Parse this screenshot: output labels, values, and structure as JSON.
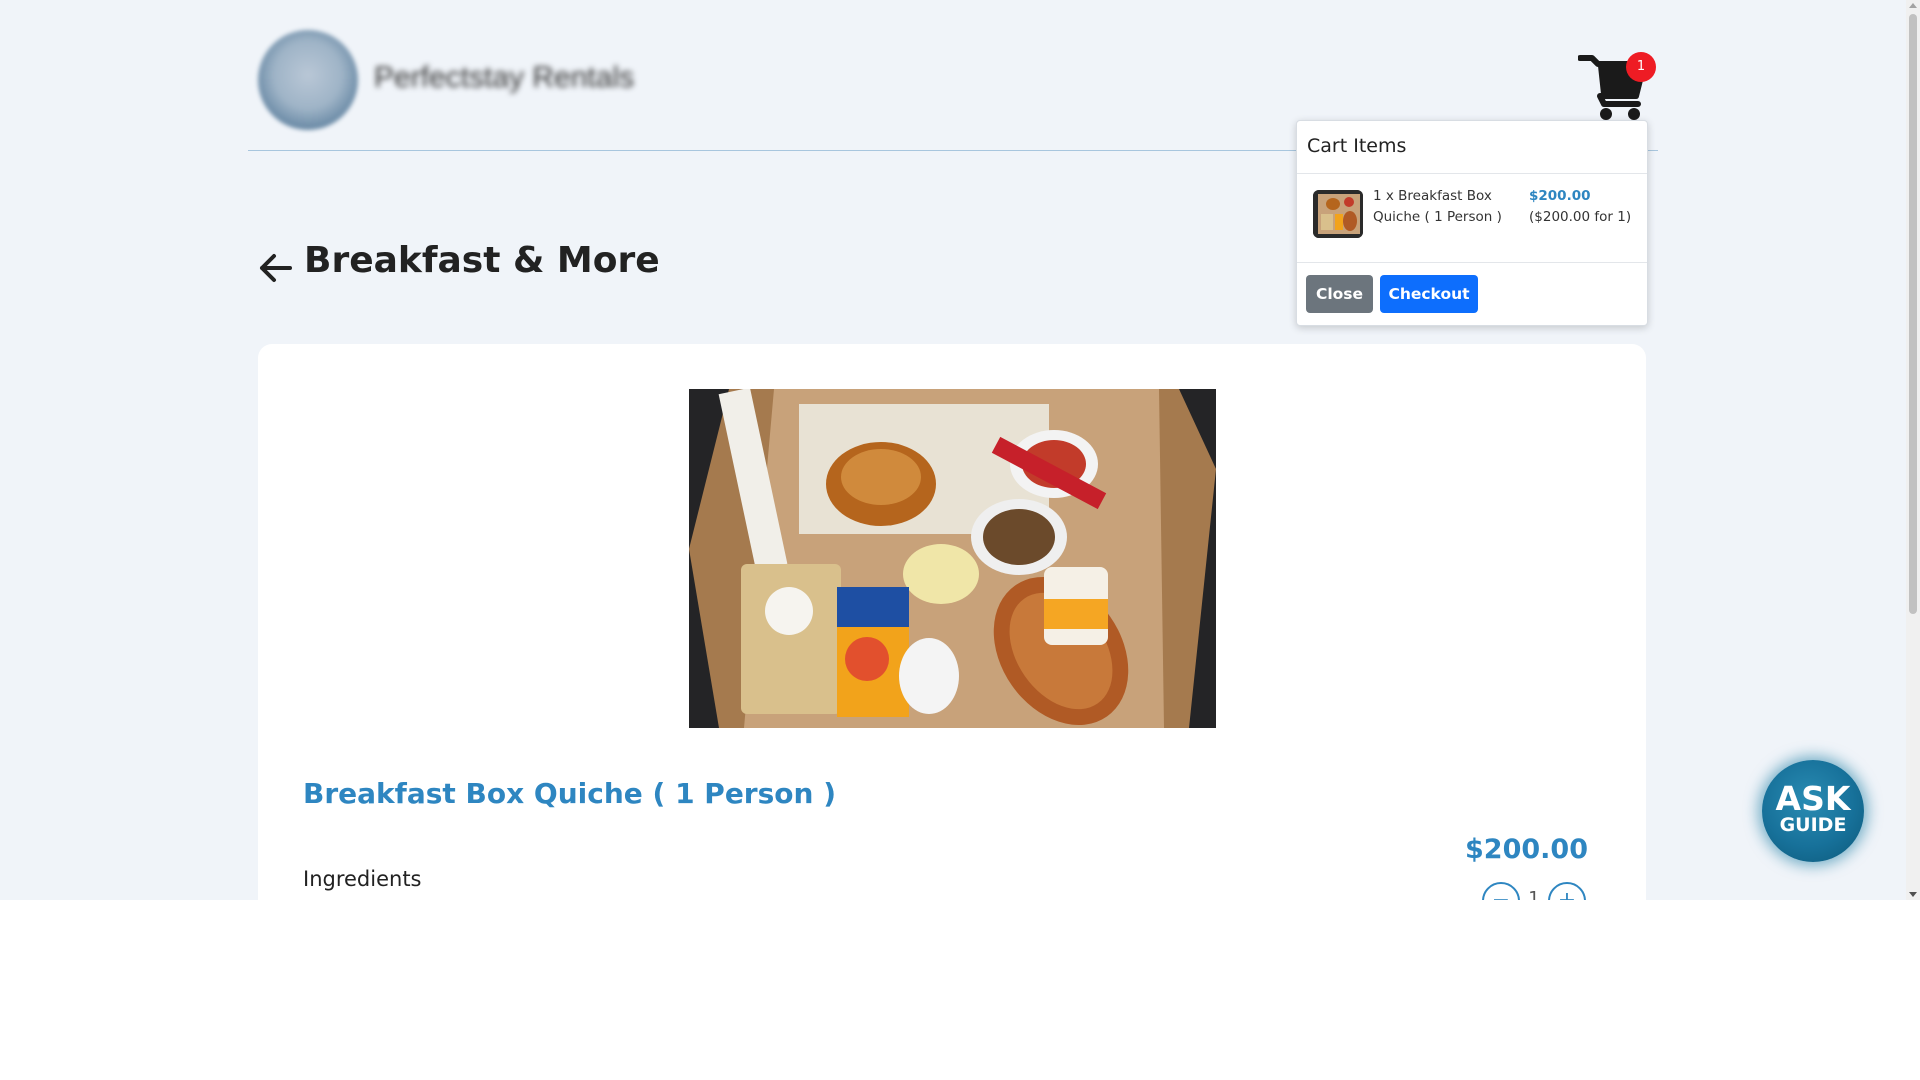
{
  "header": {
    "brand_name": "Perfectstay Rentals",
    "cart_count": "1"
  },
  "page": {
    "title": "Breakfast & More"
  },
  "product": {
    "name": "Breakfast Box Quiche ( 1 Person )",
    "ingredients_label": "Ingredients",
    "price": "$200.00",
    "quantity": "1",
    "minus_symbol": "−",
    "plus_symbol": "+"
  },
  "cart_popup": {
    "title": "Cart Items",
    "items": [
      {
        "description": "1 x Breakfast Box Quiche ( 1 Person )",
        "price": "$200.00",
        "unit_price": "($200.00 for 1)"
      }
    ],
    "close_label": "Close",
    "checkout_label": "Checkout"
  },
  "ask_guide": {
    "line1": "ASK",
    "line2": "GUIDE"
  },
  "colors": {
    "accent": "#2e86c1",
    "checkout": "#0d6efd",
    "close": "#6c757d",
    "badge": "#ee1c24",
    "background": "#f0f4f9"
  }
}
